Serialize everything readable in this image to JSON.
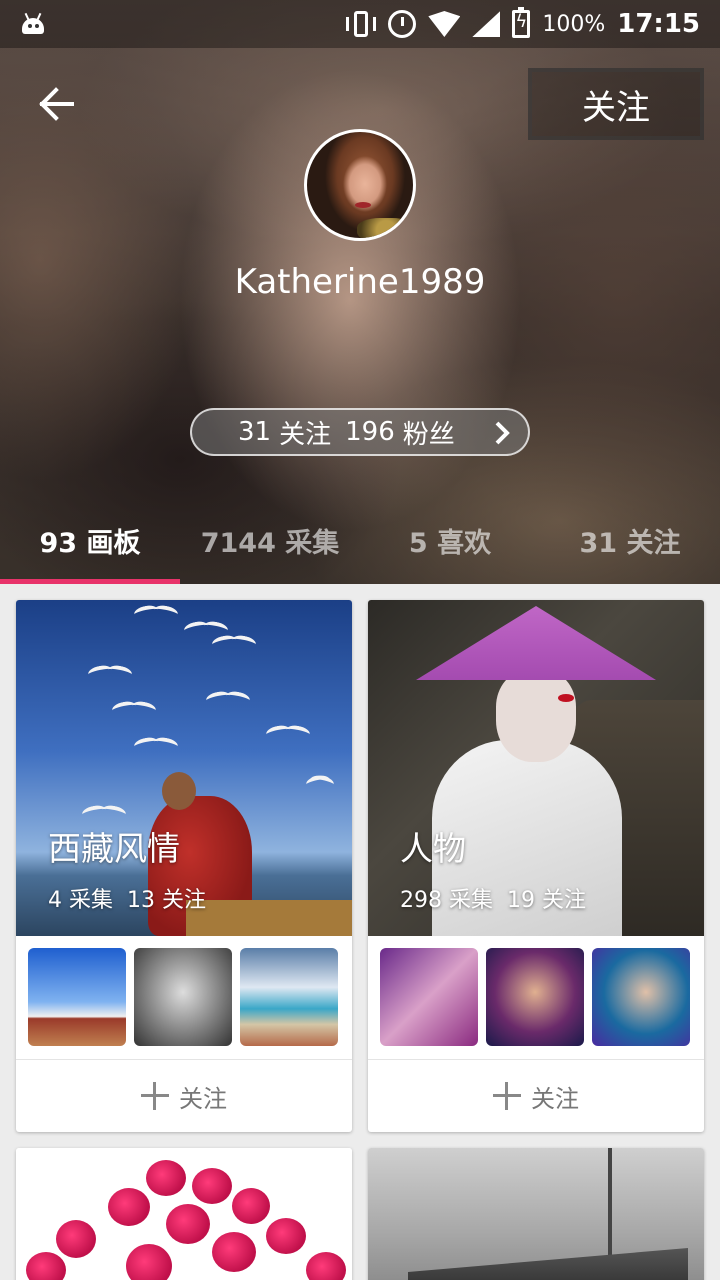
{
  "status_bar": {
    "battery": "100%",
    "time": "17:15"
  },
  "top_bar": {
    "follow_label": "关注"
  },
  "profile": {
    "username": "Katherine1989",
    "following_count": "31",
    "following_label": "关注",
    "followers_count": "196",
    "followers_label": "粉丝"
  },
  "tabs": [
    {
      "label": "93 画板",
      "active": true
    },
    {
      "label": "7144 采集",
      "active": false
    },
    {
      "label": "5 喜欢",
      "active": false
    },
    {
      "label": "31 关注",
      "active": false
    }
  ],
  "boards": [
    {
      "title": "西藏风情",
      "pins": "4 采集",
      "followers": "13 关注",
      "follow_label": "关注",
      "thumbnails": [
        "tibet-monastery-thumbnail",
        "pilgrim-bw-thumbnail",
        "lake-prayer-flags-thumbnail"
      ]
    },
    {
      "title": "人物",
      "pins": "298 采集",
      "followers": "19 关注",
      "follow_label": "关注",
      "thumbnails": [
        "purple-portrait-thumbnail",
        "indian-bride-thumbnail",
        "chinese-opera-thumbnail"
      ]
    }
  ],
  "icons": {
    "back": "arrow-left-icon",
    "chevron": "chevron-right-icon",
    "plus": "plus-icon"
  },
  "colors": {
    "accent": "#e8336a"
  }
}
